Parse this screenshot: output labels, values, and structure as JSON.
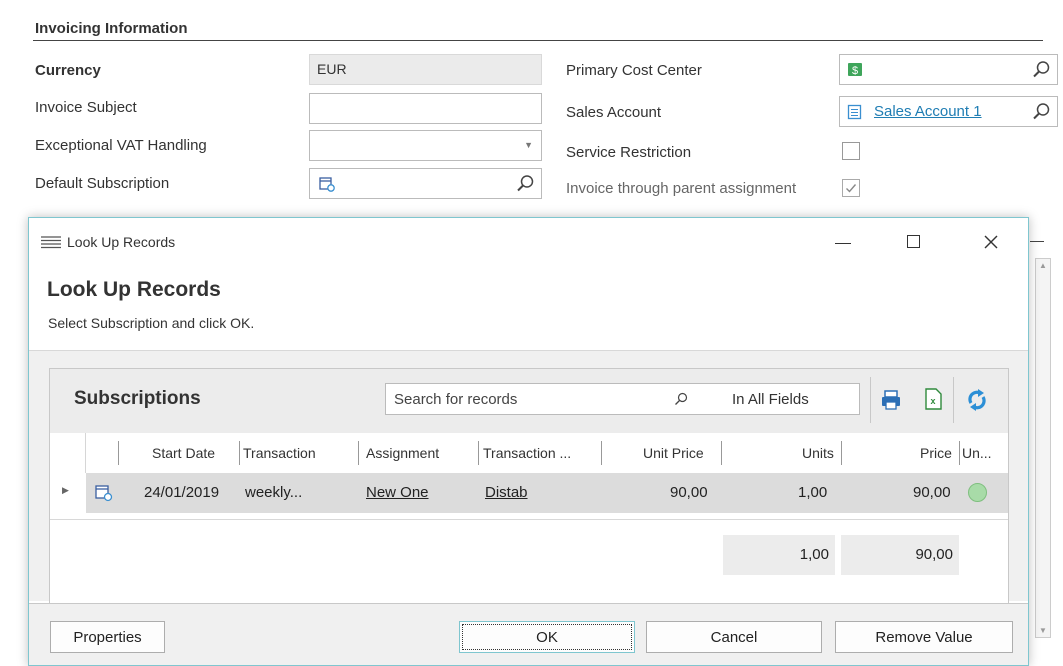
{
  "form": {
    "section_title": "Invoicing Information",
    "currency_label": "Currency",
    "currency_value": "EUR",
    "invoice_subject_label": "Invoice Subject",
    "vat_label": "Exceptional VAT Handling",
    "default_subscription_label": "Default Subscription",
    "primary_cost_center_label": "Primary Cost Center",
    "sales_account_label": "Sales Account",
    "sales_account_value": "Sales Account 1",
    "service_restriction_label": "Service Restriction",
    "invoice_parent_label": "Invoice through parent assignment",
    "invoice_parent_checked": true
  },
  "dialog": {
    "window_title": "Look Up Records",
    "heading": "Look Up Records",
    "subtitle": "Select Subscription and click OK.",
    "grid_title": "Subscriptions",
    "search_placeholder": "Search for records",
    "search_scope": "In All Fields",
    "columns": [
      "Start Date",
      "Transaction",
      "Assignment",
      "Transaction ...",
      "Unit Price",
      "Units",
      "Price",
      "Un..."
    ],
    "rows": [
      {
        "start_date": "24/01/2019",
        "transaction": "weekly...",
        "assignment": "New One",
        "transaction_type": "Distab",
        "unit_price": "90,00",
        "units": "1,00",
        "price": "90,00"
      }
    ],
    "totals": {
      "units": "1,00",
      "price": "90,00"
    },
    "buttons": {
      "properties": "Properties",
      "ok": "OK",
      "cancel": "Cancel",
      "remove": "Remove Value"
    }
  },
  "colors": {
    "accent": "#7fc6cf",
    "link": "#1f7db3",
    "cost_center_icon": "#3fa55b",
    "status_ok": "#a8dba8"
  },
  "icons": [
    "search-icon",
    "calendar-refresh-icon",
    "money-icon",
    "account-icon",
    "checkmark-icon",
    "list-icon",
    "minimize-icon",
    "maximize-icon",
    "close-icon",
    "printer-icon",
    "excel-icon",
    "refresh-icon",
    "expand-arrow-icon"
  ]
}
